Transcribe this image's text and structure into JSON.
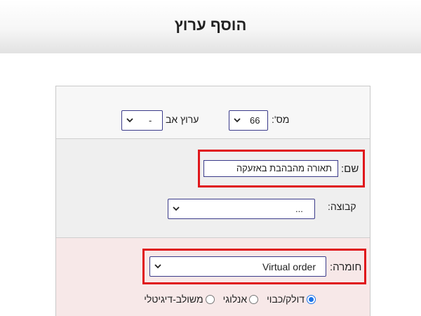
{
  "header": {
    "title": "הוסף ערוץ"
  },
  "row1": {
    "number_label": "מס':",
    "number_value": "66",
    "parent_label": "ערוץ אב",
    "parent_value": "-"
  },
  "row2": {
    "name_label": "שם:",
    "name_value": "תאורה מהבהבת באזעקה",
    "group_label": "קבוצה:",
    "group_value": "..."
  },
  "row3": {
    "hardware_label": "חומרה:",
    "hardware_value": "Virtual order"
  },
  "radios": [
    {
      "label": "דולק/כבוי",
      "selected": true
    },
    {
      "label": "אנלוגי",
      "selected": false
    },
    {
      "label": "משולב-דיגיטלי",
      "selected": false
    }
  ],
  "colors": {
    "highlight": "#e0161b",
    "field_border": "#3b3b8a",
    "hardware_bg": "#f7e8e8"
  }
}
